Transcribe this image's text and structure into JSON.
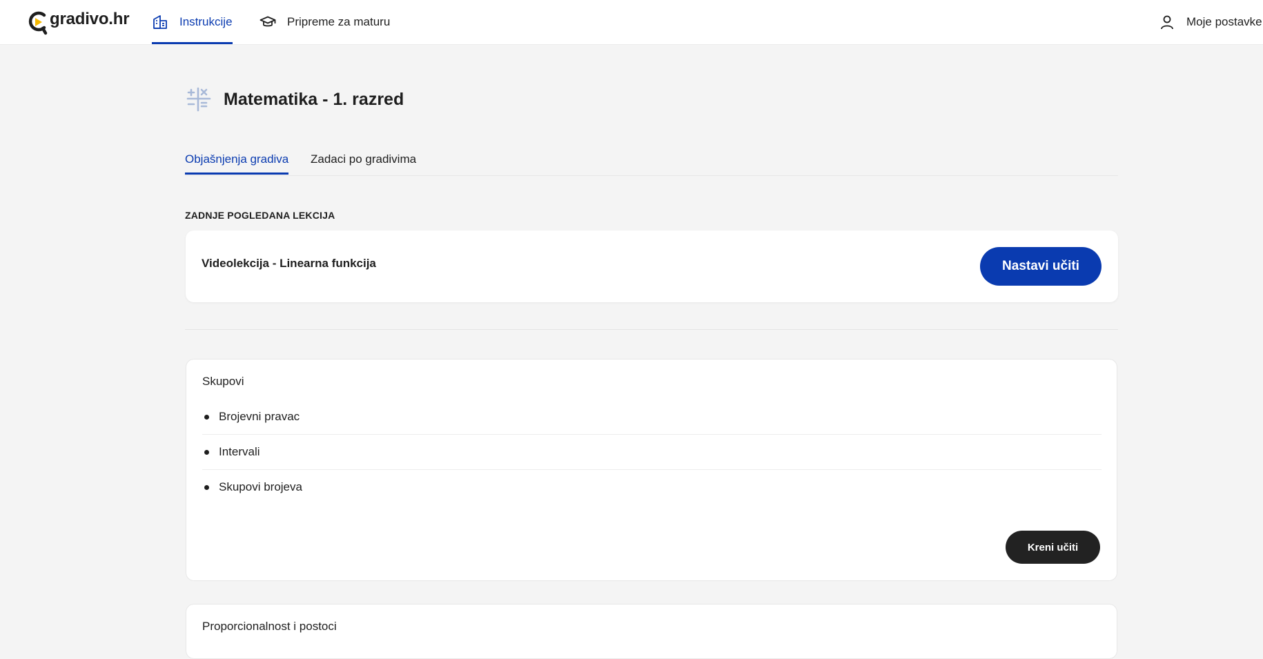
{
  "topnav": {
    "logo_text": "gradivo.hr",
    "items": [
      {
        "label": "Instrukcije",
        "icon": "building-icon",
        "active": true
      },
      {
        "label": "Pripreme za maturu",
        "icon": "graduation-cap-icon",
        "active": false
      }
    ],
    "settings_label": "Moje postavke",
    "settings_icon": "user-icon"
  },
  "subject": {
    "title": "Matematika - 1. razred",
    "icon": "math-operators-icon"
  },
  "tabs": [
    {
      "label": "Objašnjenja gradiva",
      "active": true
    },
    {
      "label": "Zadaci po gradivima",
      "active": false
    }
  ],
  "last_viewed": {
    "heading": "ZADNJE POGLEDANA LEKCIJA",
    "lesson_title": "Videolekcija - Linearna funkcija",
    "button_label": "Nastavi učiti"
  },
  "topics": [
    {
      "title": "Skupovi",
      "lessons": [
        "Brojevni pravac",
        "Intervali",
        "Skupovi brojeva"
      ],
      "button_label": "Kreni učiti"
    },
    {
      "title": "Proporcionalnost i postoci"
    }
  ],
  "colors": {
    "accent": "#0a3bb0",
    "dark_button": "#222222",
    "background": "#f4f4f4",
    "logo_yellow": "#f5b800"
  }
}
